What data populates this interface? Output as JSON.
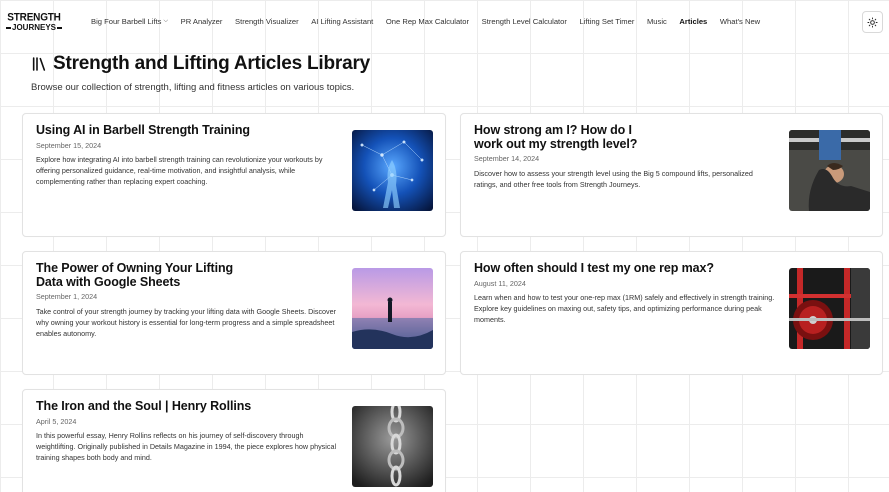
{
  "logo": {
    "line1": "STRENGTH",
    "line2": "JOURNEYS"
  },
  "nav": {
    "items": [
      {
        "label": "Big Four Barbell Lifts",
        "dropdown": true
      },
      {
        "label": "PR Analyzer"
      },
      {
        "label": "Strength Visualizer"
      },
      {
        "label": "AI Lifting Assistant"
      },
      {
        "label": "One Rep Max Calculator"
      },
      {
        "label": "Strength Level Calculator"
      },
      {
        "label": "Lifting Set Timer"
      },
      {
        "label": "Music"
      },
      {
        "label": "Articles",
        "active": true
      },
      {
        "label": "What's New"
      }
    ],
    "theme_icon": "sun-icon"
  },
  "page": {
    "icon": "library-icon",
    "title": "Strength and Lifting Articles Library",
    "subtitle": "Browse our collection of strength, lifting and fitness articles on various topics."
  },
  "articles": [
    {
      "title": "Using AI in Barbell Strength Training",
      "date": "September 15, 2024",
      "description": "Explore how integrating AI into barbell strength training can revolutionize your workouts by offering personalized guidance, real-time motivation, and insightful analysis, while complementing rather than replacing expert coaching.",
      "image": "ai-network-figure-image"
    },
    {
      "title": "How strong am I? How do I work out my strength level?",
      "date": "September 14, 2024",
      "description": "Discover how to assess your strength level using the Big 5 compound lifts, personalized ratings, and other free tools from Strength Journeys.",
      "image": "bench-press-woman-image"
    },
    {
      "title": "The Power of Owning Your Lifting Data with Google Sheets",
      "date": "September 1, 2024",
      "description": "Take control of your strength journey by tracking your lifting data with Google Sheets. Discover why owning your workout history is essential for long-term progress and a simple spreadsheet enables autonomy.",
      "image": "sunset-beach-person-image"
    },
    {
      "title": "How often should I test my one rep max?",
      "date": "August 11, 2024",
      "description": "Learn when and how to test your one-rep max (1RM) safely and effectively in strength training. Explore key guidelines on maxing out, safety tips, and optimizing performance during peak moments.",
      "image": "squat-rack-plates-image"
    },
    {
      "title": "The Iron and the Soul | Henry Rollins",
      "date": "April 5, 2024",
      "description": "In this powerful essay, Henry Rollins reflects on his journey of self-discovery through weightlifting. Originally published in Details Magazine in 1994, the piece explores how physical training shapes both body and mind.",
      "image": "chain-image"
    }
  ]
}
